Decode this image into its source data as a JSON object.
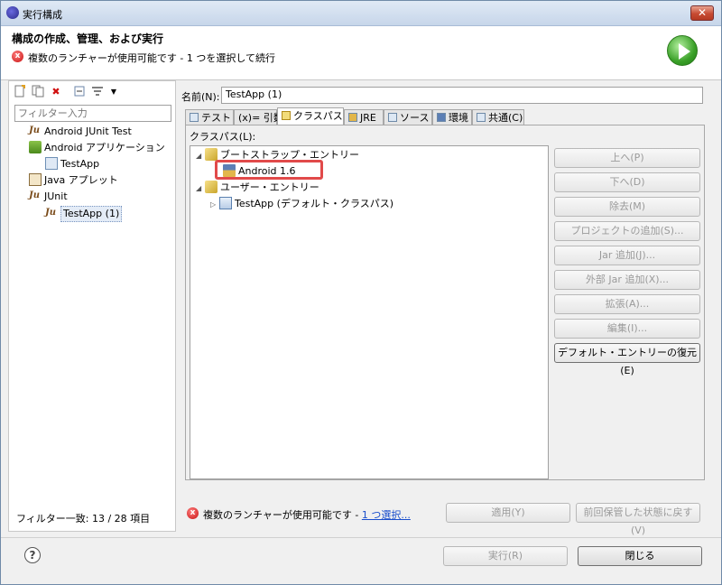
{
  "window": {
    "title": "実行構成",
    "close_glyph": "✕"
  },
  "header": {
    "title": "構成の作成、管理、および実行",
    "message": "複数のランチャーが使用可能です - 1 つを選択して続行"
  },
  "left": {
    "toolbar": [
      "new-config-icon",
      "duplicate-icon",
      "delete-icon",
      "collapse-icon",
      "filter-icon",
      "dropdown-icon"
    ],
    "filter_placeholder": "フィルター入力",
    "tree": [
      {
        "label": "Android JUnit Test",
        "icon": "android-junit-icon",
        "level": 0
      },
      {
        "label": "Android アプリケーション",
        "icon": "android-app-icon",
        "level": 0
      },
      {
        "label": "TestApp",
        "icon": "launch-config-icon",
        "level": 1
      },
      {
        "label": "Java アプレット",
        "icon": "java-applet-icon",
        "level": 0
      },
      {
        "label": "JUnit",
        "icon": "junit-icon",
        "level": 0
      },
      {
        "label": "TestApp (1)",
        "icon": "junit-icon",
        "level": 1,
        "selected": true
      }
    ],
    "footer": "フィルター一致: 13 / 28 項目"
  },
  "right": {
    "name_label": "名前(N):",
    "name_value": "TestApp (1)",
    "tabs": [
      {
        "label": "テスト"
      },
      {
        "label": "(x)= 引数"
      },
      {
        "label": "クラスパス",
        "active": true
      },
      {
        "label": "JRE"
      },
      {
        "label": "ソース"
      },
      {
        "label": "環境"
      },
      {
        "label": "共通(C)"
      }
    ],
    "classpath_label": "クラスパス(L):",
    "classpath_tree": [
      {
        "label": "ブートストラップ・エントリー",
        "level": 0,
        "expanded": true
      },
      {
        "label": "Android 1.6",
        "level": 1
      },
      {
        "label": "ユーザー・エントリー",
        "level": 0,
        "expanded": true
      },
      {
        "label": "TestApp (デフォルト・クラスパス)",
        "level": 1
      }
    ],
    "side_buttons": [
      {
        "label": "上へ(P)",
        "enabled": false
      },
      {
        "label": "下へ(D)",
        "enabled": false
      },
      {
        "label": "除去(M)",
        "enabled": false
      },
      {
        "label": "プロジェクトの追加(S)...",
        "enabled": false
      },
      {
        "label": "Jar 追加(J)...",
        "enabled": false
      },
      {
        "label": "外部 Jar 追加(X)...",
        "enabled": false
      },
      {
        "label": "拡張(A)...",
        "enabled": false
      },
      {
        "label": "編集(I)...",
        "enabled": false
      },
      {
        "label": "デフォルト・エントリーの復元(E)",
        "enabled": true
      }
    ],
    "bottom_message": "複数のランチャーが使用可能です - ",
    "bottom_link": "1 つ選択...",
    "apply_label": "適用(Y)",
    "revert_label": "前回保管した状態に戻す(V)"
  },
  "footer": {
    "run_label": "実行(R)",
    "close_label": "閉じる",
    "help_glyph": "?"
  },
  "colors": {
    "highlight": "#e14a4a",
    "link": "#1a4ecc",
    "error": "#c81010"
  }
}
